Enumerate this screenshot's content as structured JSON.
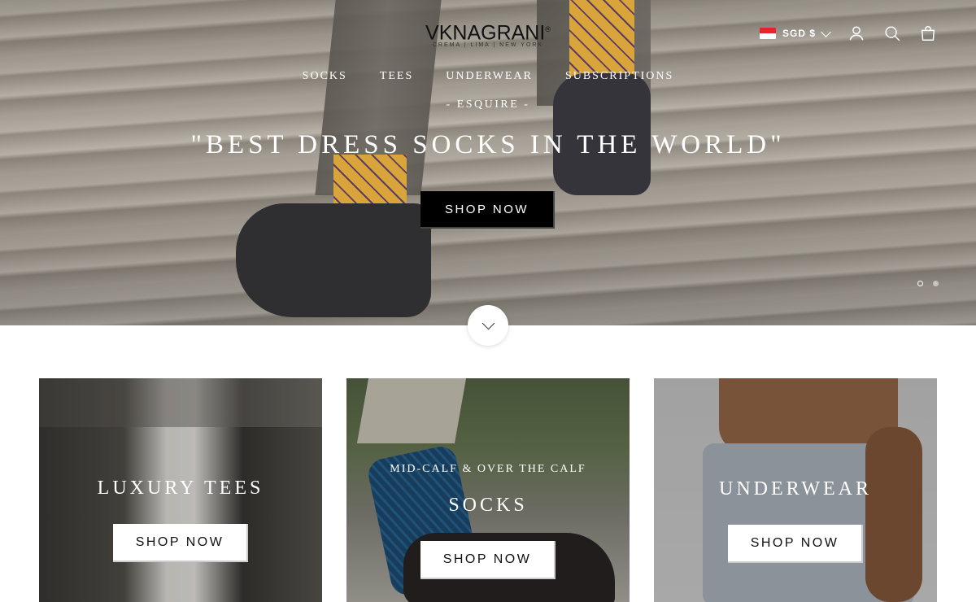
{
  "header": {
    "brand": "VKNAGRANI",
    "brand_mark": "®",
    "tagline": "CREMA | LIMA | NEW YORK",
    "currency": "SGD $",
    "nav": [
      {
        "label": "SOCKS"
      },
      {
        "label": "TEES"
      },
      {
        "label": "UNDERWEAR"
      },
      {
        "label": "SUBSCRIPTIONS"
      }
    ]
  },
  "hero": {
    "subheading": "- ESQUIRE -",
    "title": "\"BEST DRESS SOCKS IN THE WORLD\"",
    "button": "SHOP NOW",
    "slides_total": 2,
    "slide_active": 1
  },
  "collections": [
    {
      "title": "LUXURY TEES",
      "subtitle": "",
      "button": "SHOP NOW"
    },
    {
      "title": "SOCKS",
      "subtitle": "MID-CALF & OVER THE CALF",
      "button": "SHOP NOW"
    },
    {
      "title": "UNDERWEAR",
      "subtitle": "",
      "button": "SHOP NOW"
    }
  ],
  "colors": {
    "accent": "#000000",
    "flag_red": "#e1262d"
  },
  "icons": [
    "singapore-flag-icon",
    "chevron-down-icon",
    "account-icon",
    "search-icon",
    "cart-bag-icon"
  ]
}
